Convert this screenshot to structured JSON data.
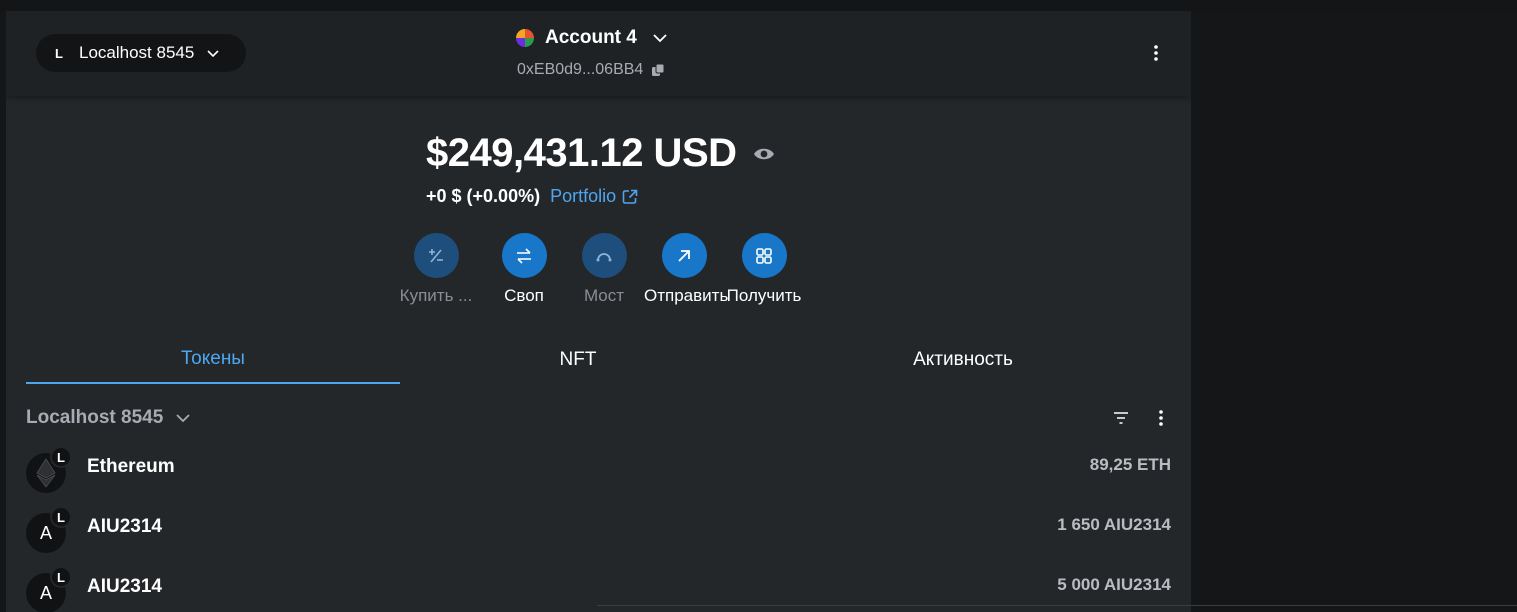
{
  "header": {
    "network": {
      "badge": "L",
      "label": "Localhost 8545"
    },
    "account": {
      "name": "Account 4",
      "address": "0xEB0d9...06BB4"
    }
  },
  "balance": {
    "amount": "$249,431.12 USD",
    "change": "+0 $ (+0.00%)",
    "portfolio_label": "Portfolio"
  },
  "actions": [
    {
      "label": "Купить ...",
      "icon": "buy-sell-icon",
      "enabled": false
    },
    {
      "label": "Своп",
      "icon": "swap-icon",
      "enabled": true
    },
    {
      "label": "Мост",
      "icon": "bridge-icon",
      "enabled": false
    },
    {
      "label": "Отправить",
      "icon": "send-icon",
      "enabled": true
    },
    {
      "label": "Получить",
      "icon": "receive-icon",
      "enabled": true
    }
  ],
  "tabs": [
    {
      "label": "Токены",
      "active": true
    },
    {
      "label": "NFT",
      "active": false
    },
    {
      "label": "Активность",
      "active": false
    }
  ],
  "token_list": {
    "network_label": "Localhost 8545",
    "tokens": [
      {
        "avatar": "",
        "badge": "L",
        "name": "Ethereum",
        "amount": "89,25 ETH",
        "icon": "ethereum-icon"
      },
      {
        "avatar": "A",
        "badge": "L",
        "name": "AIU2314",
        "amount": "1 650 AIU2314"
      },
      {
        "avatar": "A",
        "badge": "L",
        "name": "AIU2314",
        "amount": "5 000 AIU2314"
      }
    ]
  },
  "colors": {
    "accent": "#4fa6f0",
    "button_active": "#1877c9",
    "button_disabled": "#1d4e7c",
    "panel_bg": "#24272a",
    "header_bg": "#1f2225"
  }
}
